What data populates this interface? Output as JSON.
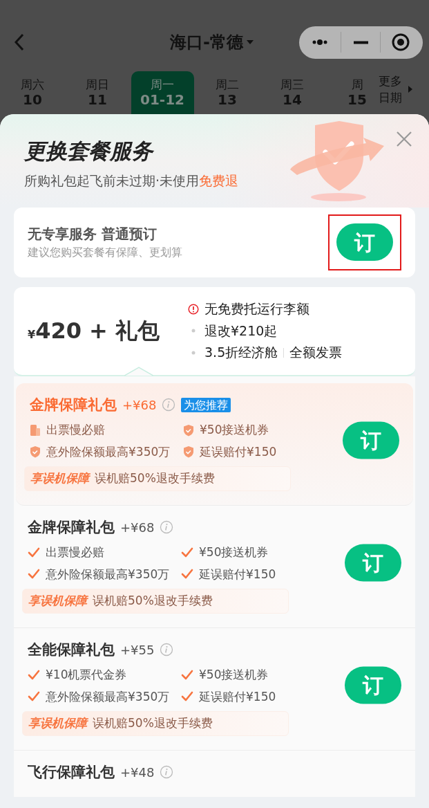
{
  "header": {
    "title": "海口-常德"
  },
  "dates": [
    {
      "weekday": "周六",
      "day": "10",
      "selected": false
    },
    {
      "weekday": "周日",
      "day": "11",
      "selected": false
    },
    {
      "weekday": "周一",
      "day": "01-12",
      "selected": true
    },
    {
      "weekday": "周二",
      "day": "13",
      "selected": false
    },
    {
      "weekday": "周三",
      "day": "14",
      "selected": false
    },
    {
      "weekday": "周",
      "day": "15",
      "selected": false
    }
  ],
  "more_dates": "更多日期",
  "sheet": {
    "title": "更换套餐服务",
    "subtitle": "所购礼包起飞前未过期·未使用",
    "subtitle_highlight": "免费退"
  },
  "basic": {
    "title": "无专享服务 普通预订",
    "hint": "建议您购买套餐有保障、更划算",
    "button": "订",
    "highlighted": true
  },
  "fare": {
    "currency": "¥",
    "amount": "420 + 礼包",
    "notes": [
      {
        "kind": "warning",
        "text": "无免费托运行李额"
      },
      {
        "kind": "bullet",
        "text": "退改¥210起"
      },
      {
        "kind": "bullet",
        "text": "3.5折经济舱",
        "extra": "全额发票"
      }
    ]
  },
  "packages": [
    {
      "name": "金牌保障礼包",
      "price": "+¥68",
      "recommended": true,
      "badge": "为您推荐",
      "features": [
        {
          "kind": "ticket",
          "text": "出票慢必赔"
        },
        {
          "kind": "shield",
          "text": "¥50接送机券"
        },
        {
          "kind": "shield",
          "text": "意外险保额最高¥350万"
        },
        {
          "kind": "shield",
          "text": "延误赔付¥150"
        }
      ],
      "perk_label": "享误机保障",
      "perk_text": "误机赔50%退改手续费",
      "button": "订"
    },
    {
      "name": "金牌保障礼包",
      "price": "+¥68",
      "recommended": false,
      "features": [
        {
          "kind": "check",
          "text": "出票慢必赔"
        },
        {
          "kind": "check",
          "text": "¥50接送机券"
        },
        {
          "kind": "check",
          "text": "意外险保额最高¥350万"
        },
        {
          "kind": "check",
          "text": "延误赔付¥150"
        }
      ],
      "perk_label": "享误机保障",
      "perk_text": "误机赔50%退改手续费",
      "button": "订"
    },
    {
      "name": "全能保障礼包",
      "price": "+¥55",
      "recommended": false,
      "features": [
        {
          "kind": "check",
          "text": "¥10机票代金券"
        },
        {
          "kind": "check",
          "text": "¥50接送机券"
        },
        {
          "kind": "check",
          "text": "意外险保额最高¥350万"
        },
        {
          "kind": "check",
          "text": "延误赔付¥150"
        }
      ],
      "perk_label": "享误机保障",
      "perk_text": "误机赔50%退改手续费",
      "button": "订"
    },
    {
      "name": "飞行保障礼包",
      "price": "+¥48",
      "recommended": false
    }
  ]
}
